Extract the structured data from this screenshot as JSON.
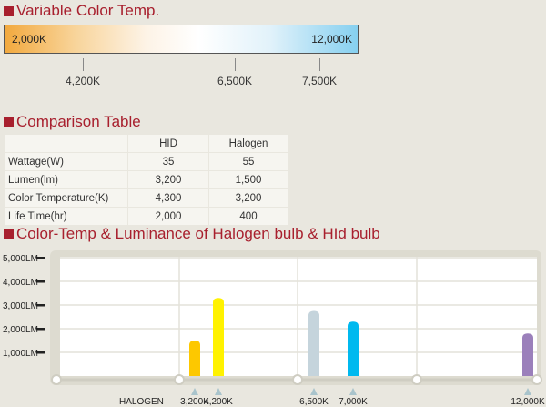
{
  "sections": {
    "color_temp": "Variable Color Temp.",
    "table": "Comparison Table",
    "chart": "Color-Temp & Luminance of Halogen bulb & HId bulb"
  },
  "color_bar": {
    "left": "2,000K",
    "right": "12,000K",
    "ticks": [
      "4,200K",
      "6,500K",
      "7,500K"
    ]
  },
  "table": {
    "headers": [
      "",
      "HID",
      "Halogen"
    ],
    "rows": [
      [
        "Wattage(W)",
        "35",
        "55"
      ],
      [
        "Lumen(lm)",
        "3,200",
        "1,500"
      ],
      [
        "Color Temperature(K)",
        "4,300",
        "3,200"
      ],
      [
        "Life Time(hr)",
        "2,000",
        "400"
      ]
    ]
  },
  "chart_data": {
    "type": "bar",
    "title": "Color-Temp & Luminance of Halogen bulb & HId bulb",
    "ylim": [
      0,
      5000
    ],
    "yticks": [
      "1,000LM",
      "2,000LM",
      "3,000LM",
      "4,000LM",
      "5,000LM"
    ],
    "x_prefix": "HALOGEN",
    "categories": [
      "3,200K",
      "4,200K",
      "6,500K",
      "7,000K",
      "12,000K"
    ],
    "values": [
      1500,
      3300,
      2750,
      2300,
      1800
    ],
    "colors": [
      "#fdc800",
      "#fff200",
      "#c5d4dc",
      "#00b9ef",
      "#9b80bb"
    ],
    "grid": true
  }
}
